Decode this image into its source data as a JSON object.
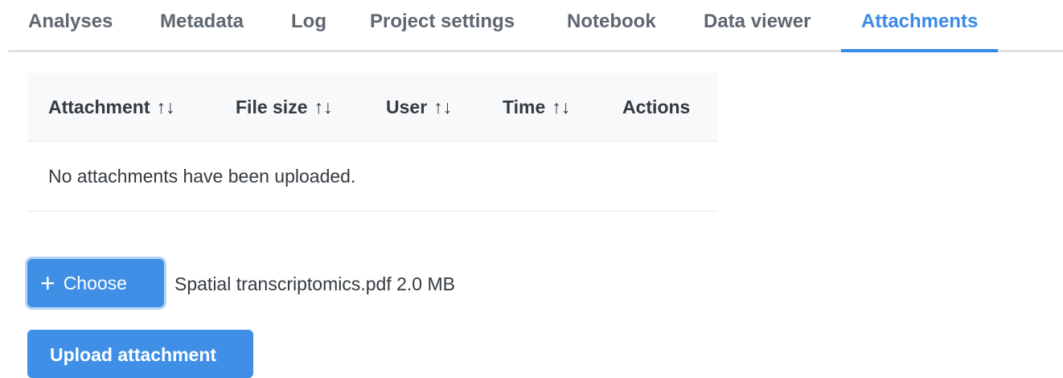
{
  "tabs": [
    {
      "label": "Analyses",
      "active": false
    },
    {
      "label": "Metadata",
      "active": false
    },
    {
      "label": "Log",
      "active": false
    },
    {
      "label": "Project settings",
      "active": false
    },
    {
      "label": "Notebook",
      "active": false
    },
    {
      "label": "Data viewer",
      "active": false
    },
    {
      "label": "Attachments",
      "active": true
    }
  ],
  "table": {
    "columns": [
      {
        "label": "Attachment",
        "sortable": true
      },
      {
        "label": "File size",
        "sortable": true
      },
      {
        "label": "User",
        "sortable": true
      },
      {
        "label": "Time",
        "sortable": true
      },
      {
        "label": "Actions",
        "sortable": false
      }
    ],
    "sort_icon": "↑↓",
    "empty_message": "No attachments have been uploaded."
  },
  "upload": {
    "choose_icon": "+",
    "choose_label": "Choose",
    "selected_file": "Spatial transcriptomics.pdf 2.0 MB",
    "upload_label": "Upload attachment"
  },
  "colors": {
    "accent": "#3b8ae6",
    "tab_inactive": "#5f6770",
    "header_bg": "#f8f9fa"
  }
}
